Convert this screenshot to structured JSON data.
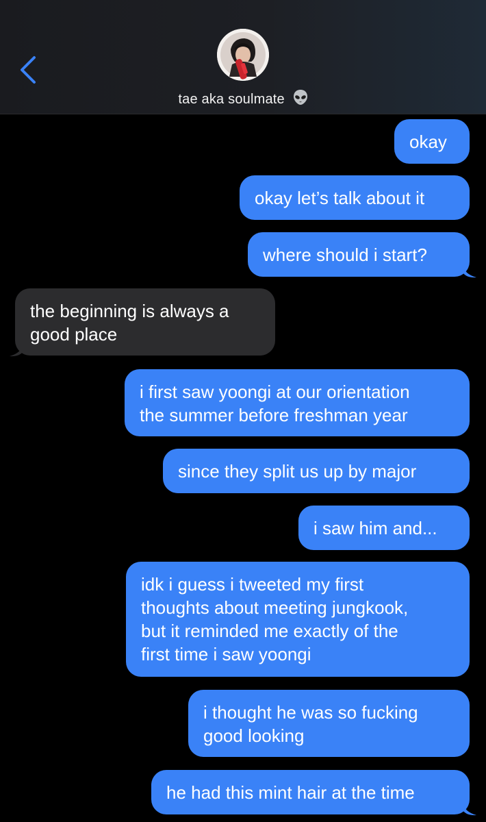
{
  "header": {
    "back_icon": "chevron-left-icon",
    "contact_name": "tae aka soulmate",
    "contact_emoji": "alien-icon",
    "accent_color": "#3a82f7"
  },
  "messages": [
    {
      "direction": "outgoing",
      "lines": [
        "okay"
      ]
    },
    {
      "direction": "outgoing",
      "lines": [
        "okay let’s talk about it"
      ]
    },
    {
      "direction": "outgoing",
      "lines": [
        "where should i start?"
      ]
    },
    {
      "direction": "incoming",
      "lines": [
        "the beginning is always a",
        "good place"
      ]
    },
    {
      "direction": "outgoing",
      "lines": [
        "i first saw yoongi at our orientation",
        "the summer before freshman year"
      ]
    },
    {
      "direction": "outgoing",
      "lines": [
        "since they split us up by major"
      ]
    },
    {
      "direction": "outgoing",
      "lines": [
        "i saw him and..."
      ]
    },
    {
      "direction": "outgoing",
      "lines": [
        "idk i guess i tweeted my first",
        "thoughts about meeting jungkook,",
        "but it reminded me exactly of the",
        "first time i saw yoongi"
      ]
    },
    {
      "direction": "outgoing",
      "lines": [
        "i thought he was so fucking",
        "good looking"
      ]
    },
    {
      "direction": "outgoing",
      "lines": [
        "he had this mint hair at the time"
      ]
    }
  ],
  "colors": {
    "outgoing_bubble": "#3a82f7",
    "incoming_bubble": "#2c2c2e",
    "background": "#000000"
  }
}
